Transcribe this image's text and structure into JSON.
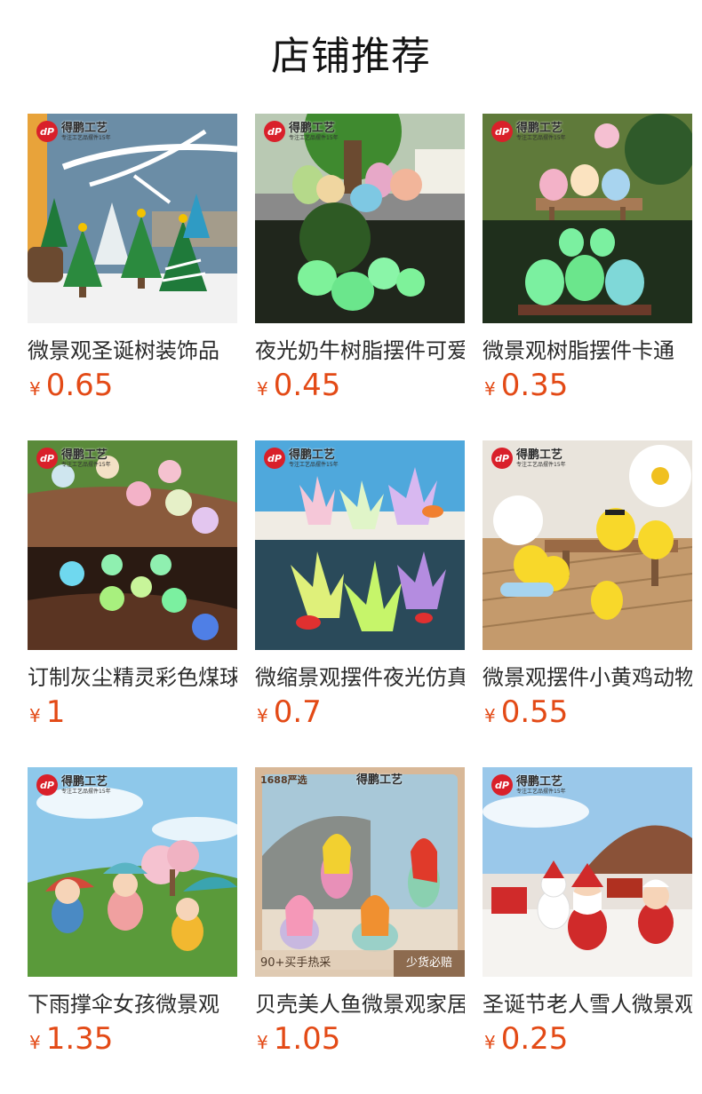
{
  "page": {
    "title": "店铺推荐"
  },
  "brand": {
    "logo_mark": "dP",
    "logo_name": "得鹏工艺",
    "logo_tagline": "专注工艺品摆件15年"
  },
  "currency": "¥",
  "products": [
    {
      "name": "微景观圣诞树装饰品",
      "price": "0.65",
      "image": "christmas-trees"
    },
    {
      "name": "夜光奶牛树脂摆件可爱",
      "price": "0.45",
      "image": "glow-cows"
    },
    {
      "name": "微景观树脂摆件卡通",
      "price": "0.35",
      "image": "glow-birds"
    },
    {
      "name": "订制灰尘精灵彩色煤球",
      "price": "1",
      "image": "dust-sprites"
    },
    {
      "name": "微缩景观摆件夜光仿真",
      "price": "0.7",
      "image": "glow-coral"
    },
    {
      "name": "微景观摆件小黄鸡动物",
      "price": "0.55",
      "image": "yellow-chicks"
    },
    {
      "name": "下雨撑伞女孩微景观",
      "price": "1.35",
      "image": "umbrella-kids"
    },
    {
      "name": "贝壳美人鱼微景观家居",
      "price": "1.05",
      "image": "mermaids",
      "badge": "1688严选",
      "promo_left": "90+买手热采",
      "promo_right": "少货必赔"
    },
    {
      "name": "圣诞节老人雪人微景观",
      "price": "0.25",
      "image": "santa-snowman"
    }
  ],
  "colors": {
    "price": "#e34a16",
    "title": "#141414",
    "name": "#2b2b2b"
  }
}
